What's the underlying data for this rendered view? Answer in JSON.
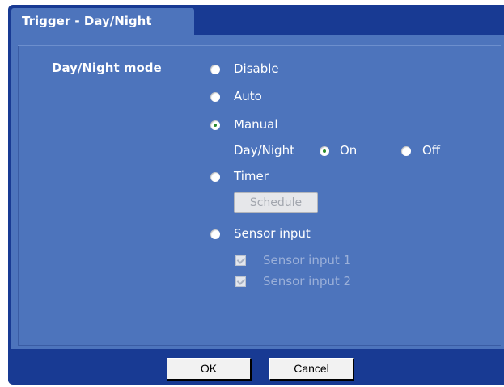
{
  "tab": {
    "title": "Trigger - Day/Night"
  },
  "form": {
    "mode_label": "Day/Night mode",
    "options": [
      {
        "label": "Disable",
        "checked": false
      },
      {
        "label": "Auto",
        "checked": false
      },
      {
        "label": "Manual",
        "checked": true
      },
      {
        "label": "Timer",
        "checked": false
      },
      {
        "label": "Sensor input",
        "checked": false
      }
    ],
    "manual_sub": {
      "label": "Day/Night",
      "on_label": "On",
      "off_label": "Off",
      "selected": "On"
    },
    "schedule_button": "Schedule",
    "sensor_inputs": [
      {
        "label": "Sensor input 1",
        "checked": true,
        "disabled": true
      },
      {
        "label": "Sensor input 2",
        "checked": true,
        "disabled": true
      }
    ]
  },
  "footer": {
    "ok": "OK",
    "cancel": "Cancel"
  },
  "colors": {
    "frame_dark": "#183a93",
    "panel": "#4d74bc",
    "radio_selected_dot": "#2b8a2b"
  }
}
